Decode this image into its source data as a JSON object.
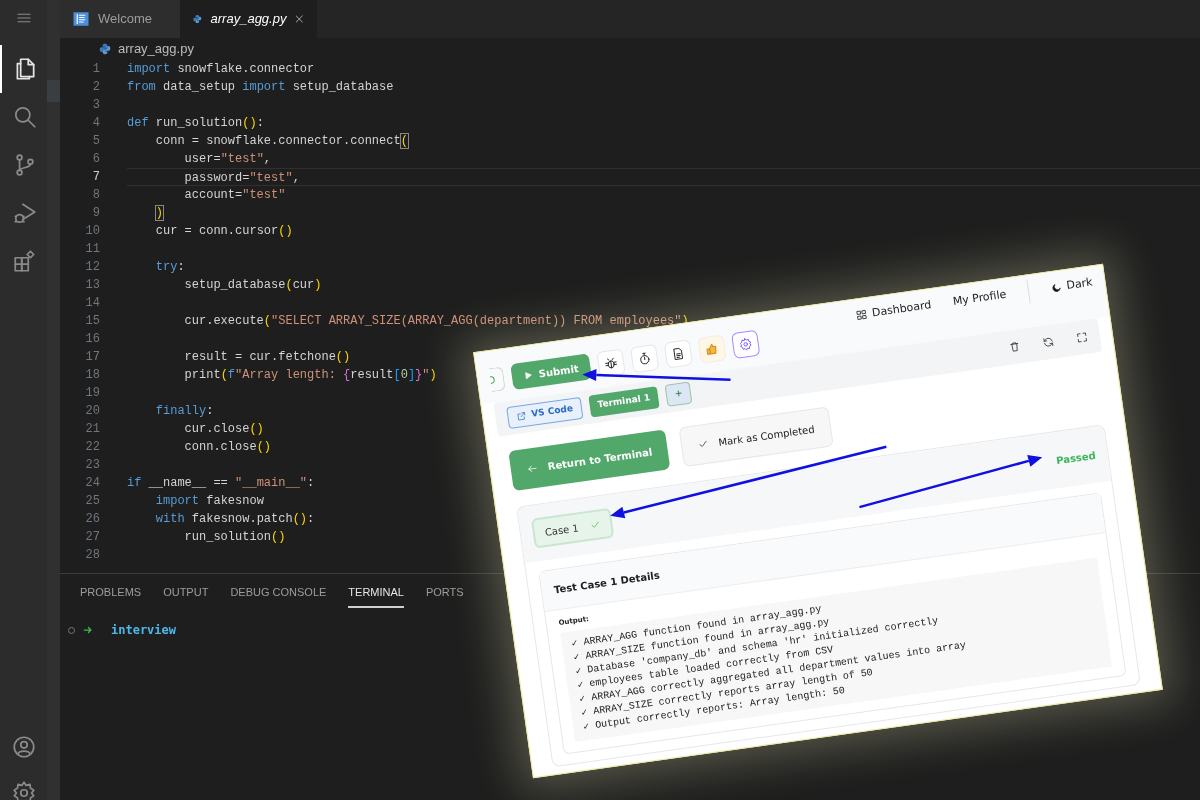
{
  "activity_bar": {
    "items": [
      {
        "kind": "files",
        "selected": true
      },
      {
        "kind": "search",
        "selected": false
      },
      {
        "kind": "source-control",
        "selected": false
      },
      {
        "kind": "run-debug",
        "selected": false
      },
      {
        "kind": "extensions",
        "selected": false
      }
    ],
    "bottom": [
      {
        "kind": "account"
      },
      {
        "kind": "settings"
      }
    ]
  },
  "editor_tabs": [
    {
      "label": "Welcome",
      "kind": "welcome",
      "selected": false
    },
    {
      "label": "array_agg.py",
      "kind": "python",
      "selected": true
    }
  ],
  "breadcrumb": "array_agg.py",
  "code_lines": [
    {
      "number": "1",
      "current": false,
      "tokens": [
        {
          "kind": "kw",
          "text": "import"
        },
        {
          "kind": "tx",
          "text": " snowflake.connector"
        }
      ]
    },
    {
      "number": "2",
      "current": false,
      "tokens": [
        {
          "kind": "kw",
          "text": "from"
        },
        {
          "kind": "tx",
          "text": " data_setup "
        },
        {
          "kind": "kw",
          "text": "import"
        },
        {
          "kind": "tx",
          "text": " setup_database"
        }
      ]
    },
    {
      "number": "3",
      "current": false
    },
    {
      "number": "4",
      "current": false,
      "tokens": [
        {
          "kind": "kw",
          "text": "def"
        },
        {
          "kind": "tx",
          "text": " run_solution"
        },
        {
          "kind": "br",
          "text": "()"
        },
        {
          "kind": "tx",
          "text": ":"
        }
      ]
    },
    {
      "number": "5",
      "current": false,
      "tokens": [
        {
          "kind": "tx",
          "text": "    conn = snowflake.connector.connect"
        },
        {
          "kind": "brm",
          "text": "("
        }
      ]
    },
    {
      "number": "6",
      "current": false,
      "tokens": [
        {
          "kind": "tx",
          "text": "        user="
        },
        {
          "kind": "str",
          "text": "\"test\""
        },
        {
          "kind": "tx",
          "text": ","
        }
      ]
    },
    {
      "number": "7",
      "current": true,
      "tokens": [
        {
          "kind": "tx",
          "text": "        password="
        },
        {
          "kind": "str",
          "text": "\"test\""
        },
        {
          "kind": "tx",
          "text": ","
        }
      ]
    },
    {
      "number": "8",
      "current": false,
      "tokens": [
        {
          "kind": "tx",
          "text": "        account="
        },
        {
          "kind": "str",
          "text": "\"test\""
        }
      ]
    },
    {
      "number": "9",
      "current": false,
      "tokens": [
        {
          "kind": "brm",
          "text": "    )"
        }
      ]
    },
    {
      "number": "10",
      "current": false,
      "tokens": [
        {
          "kind": "tx",
          "text": "    cur = conn.cursor"
        },
        {
          "kind": "br",
          "text": "()"
        }
      ]
    },
    {
      "number": "11",
      "current": false
    },
    {
      "number": "12",
      "current": false,
      "tokens": [
        {
          "kind": "kw",
          "text": "    try"
        },
        {
          "kind": "tx",
          "text": ":"
        }
      ]
    },
    {
      "number": "13",
      "current": false,
      "tokens": [
        {
          "kind": "tx",
          "text": "        setup_database"
        },
        {
          "kind": "br",
          "text": "("
        },
        {
          "kind": "tx",
          "text": "cur"
        },
        {
          "kind": "br",
          "text": ")"
        }
      ]
    },
    {
      "number": "14",
      "current": false
    },
    {
      "number": "15",
      "current": false,
      "tokens": [
        {
          "kind": "tx",
          "text": "        cur.execute"
        },
        {
          "kind": "br",
          "text": "("
        },
        {
          "kind": "str",
          "text": "\"SELECT ARRAY_SIZE(ARRAY_AGG(department)) FROM employees\""
        },
        {
          "kind": "br",
          "text": ")"
        }
      ]
    },
    {
      "number": "16",
      "current": false
    },
    {
      "number": "17",
      "current": false,
      "tokens": [
        {
          "kind": "tx",
          "text": "        result = cur.fetchone"
        },
        {
          "kind": "br",
          "text": "()"
        }
      ]
    },
    {
      "number": "18",
      "current": false,
      "tokens": [
        {
          "kind": "tx",
          "text": "        print"
        },
        {
          "kind": "br",
          "text": "("
        },
        {
          "kind": "kw",
          "text": "f"
        },
        {
          "kind": "str",
          "text": "\"Array length: "
        },
        {
          "kind": "brp",
          "text": "{"
        },
        {
          "kind": "tx",
          "text": "result"
        },
        {
          "kind": "brb",
          "text": "["
        },
        {
          "kind": "num",
          "text": "0"
        },
        {
          "kind": "brb",
          "text": "]"
        },
        {
          "kind": "brp",
          "text": "}"
        },
        {
          "kind": "str",
          "text": "\""
        },
        {
          "kind": "br",
          "text": ")"
        }
      ]
    },
    {
      "number": "19",
      "current": false
    },
    {
      "number": "20",
      "current": false,
      "tokens": [
        {
          "kind": "kw",
          "text": "    finally"
        },
        {
          "kind": "tx",
          "text": ":"
        }
      ]
    },
    {
      "number": "21",
      "current": false,
      "tokens": [
        {
          "kind": "tx",
          "text": "        cur.close"
        },
        {
          "kind": "br",
          "text": "()"
        }
      ]
    },
    {
      "number": "22",
      "current": false,
      "tokens": [
        {
          "kind": "tx",
          "text": "        conn.close"
        },
        {
          "kind": "br",
          "text": "()"
        }
      ]
    },
    {
      "number": "23",
      "current": false
    },
    {
      "number": "24",
      "current": false,
      "tokens": [
        {
          "kind": "kw",
          "text": "if"
        },
        {
          "kind": "tx",
          "text": " __name__ == "
        },
        {
          "kind": "str",
          "text": "\"__main__\""
        },
        {
          "kind": "tx",
          "text": ":"
        }
      ]
    },
    {
      "number": "25",
      "current": false,
      "tokens": [
        {
          "kind": "kw",
          "text": "    import"
        },
        {
          "kind": "tx",
          "text": " fakesnow"
        }
      ]
    },
    {
      "number": "26",
      "current": false,
      "tokens": [
        {
          "kind": "kw",
          "text": "    with"
        },
        {
          "kind": "tx",
          "text": " fakesnow.patch"
        },
        {
          "kind": "br",
          "text": "()"
        },
        {
          "kind": "tx",
          "text": ":"
        }
      ]
    },
    {
      "number": "27",
      "current": false,
      "tokens": [
        {
          "kind": "tx",
          "text": "        run_solution"
        },
        {
          "kind": "br",
          "text": "()"
        }
      ]
    },
    {
      "number": "28",
      "current": false
    }
  ],
  "panel": {
    "tabs": [
      {
        "label": "PROBLEMS",
        "selected": false
      },
      {
        "label": "OUTPUT",
        "selected": false
      },
      {
        "label": "DEBUG CONSOLE",
        "selected": false
      },
      {
        "label": "TERMINAL",
        "selected": true
      },
      {
        "label": "PORTS",
        "selected": false
      }
    ],
    "terminal_prompt": {
      "directory": "interview"
    }
  },
  "overlay": {
    "toolbar": {
      "submit": "Submit",
      "tools": [
        {
          "kind": "bug"
        },
        {
          "kind": "timer"
        },
        {
          "kind": "document"
        },
        {
          "kind": "thumbs-up"
        },
        {
          "kind": "settings"
        }
      ]
    },
    "nav": {
      "links": [
        {
          "label": "Dashboard",
          "kind": "grid"
        },
        {
          "label": "My Profile",
          "kind": "plain"
        }
      ],
      "theme_toggle": "Dark"
    },
    "terminal_tabs": [
      {
        "label": "VS Code",
        "kind": "external"
      },
      {
        "label": "Terminal 1",
        "kind": "terminal"
      },
      {
        "label": "+",
        "kind": "add"
      }
    ],
    "panel_actions": [
      {
        "kind": "trash"
      },
      {
        "kind": "refresh"
      },
      {
        "kind": "fullscreen"
      }
    ],
    "buttons": [
      {
        "label": "Return to Terminal",
        "kind": "primary"
      },
      {
        "label": "Mark as Completed",
        "kind": "secondary"
      }
    ],
    "test_case": {
      "label": "Case 1",
      "passed": true,
      "status": "Passed"
    },
    "details": {
      "title": "Test Case 1 Details",
      "output_label": "Output:",
      "lines": [
        "✓ ARRAY_AGG function found in array_agg.py",
        "✓ ARRAY_SIZE function found in array_agg.py",
        "✓ Database 'company_db' and schema 'hr' initialized correctly",
        "✓ employees table loaded correctly from CSV",
        "✓ ARRAY_AGG correctly aggregated all department values into array",
        "✓ ARRAY_SIZE correctly reports array length of 50",
        "✓ Output correctly reports: Array length: 50"
      ]
    }
  }
}
